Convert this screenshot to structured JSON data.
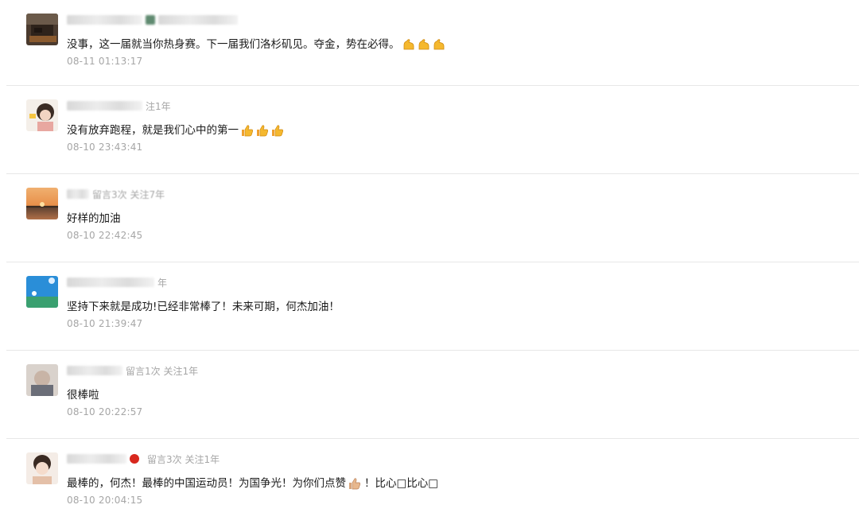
{
  "comments": [
    {
      "meta": "",
      "text": "没事，这一届就当你热身赛。下一届我们洛杉矶见。夺金，势在必得。",
      "emoji": "muscle-icon",
      "emoji_count": 3,
      "after_text": "",
      "time": "08-11 01:13:17"
    },
    {
      "meta": "注1年",
      "text": "没有放弃跑程，就是我们心中的第一",
      "emoji": "thumbs-up-icon",
      "emoji_count": 3,
      "after_text": "",
      "time": "08-10 23:43:41"
    },
    {
      "meta": "留言3次 关注7年",
      "text": "好样的加油",
      "emoji": "",
      "emoji_count": 0,
      "after_text": "",
      "time": "08-10 22:42:45"
    },
    {
      "meta": "年",
      "text": "坚持下来就是成功!已经非常棒了！未来可期，何杰加油！",
      "emoji": "",
      "emoji_count": 0,
      "after_text": "",
      "time": "08-10 21:39:47"
    },
    {
      "meta": "留言1次 关注1年",
      "text": "很棒啦",
      "emoji": "",
      "emoji_count": 0,
      "after_text": "",
      "time": "08-10 20:22:57"
    },
    {
      "meta": "留言3次 关注1年",
      "text": "最棒的，何杰！最棒的中国运动员！为国争光！为你们点赞",
      "emoji": "thumbs-up-icon",
      "emoji_count": 1,
      "after_text": "！比心□比心□",
      "time": "08-10 20:04:15"
    }
  ],
  "colors": {
    "text": "#1a1a1a",
    "meta": "#a6a6a6",
    "divider": "#e7e7e7",
    "emoji_yellow": "#f5b82e"
  }
}
